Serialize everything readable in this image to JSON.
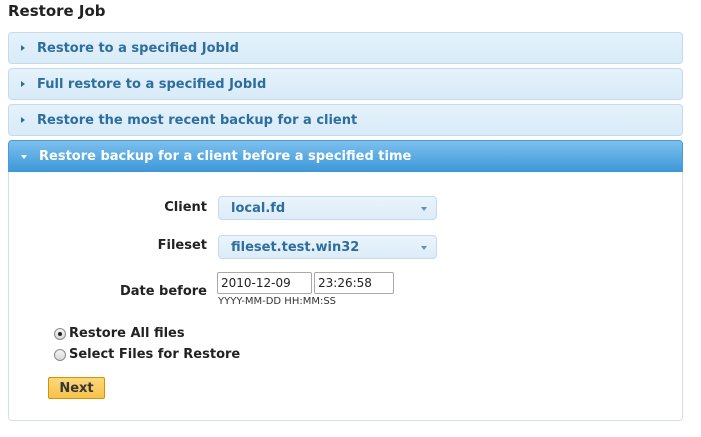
{
  "page": {
    "title": "Restore Job"
  },
  "accordion": {
    "items": [
      {
        "label": "Restore to a specified JobId"
      },
      {
        "label": "Full restore to a specified JobId"
      },
      {
        "label": "Restore the most recent backup for a client"
      },
      {
        "label": "Restore backup for a client before a specified time"
      }
    ]
  },
  "form": {
    "client": {
      "label": "Client",
      "value": "local.fd"
    },
    "fileset": {
      "label": "Fileset",
      "value": "fileset.test.win32"
    },
    "date_before": {
      "label": "Date before",
      "date_value": "2010-12-09",
      "time_value": "23:26:58",
      "hint": "YYYY-MM-DD HH:MM:SS"
    },
    "restore_options": [
      {
        "label": "Restore All files",
        "checked": true
      },
      {
        "label": "Select Files for Restore",
        "checked": false
      }
    ],
    "next_label": "Next"
  },
  "colors": {
    "accent": "#2e6e9e",
    "active_header": "#3d97d8",
    "button": "#f8c14a"
  }
}
